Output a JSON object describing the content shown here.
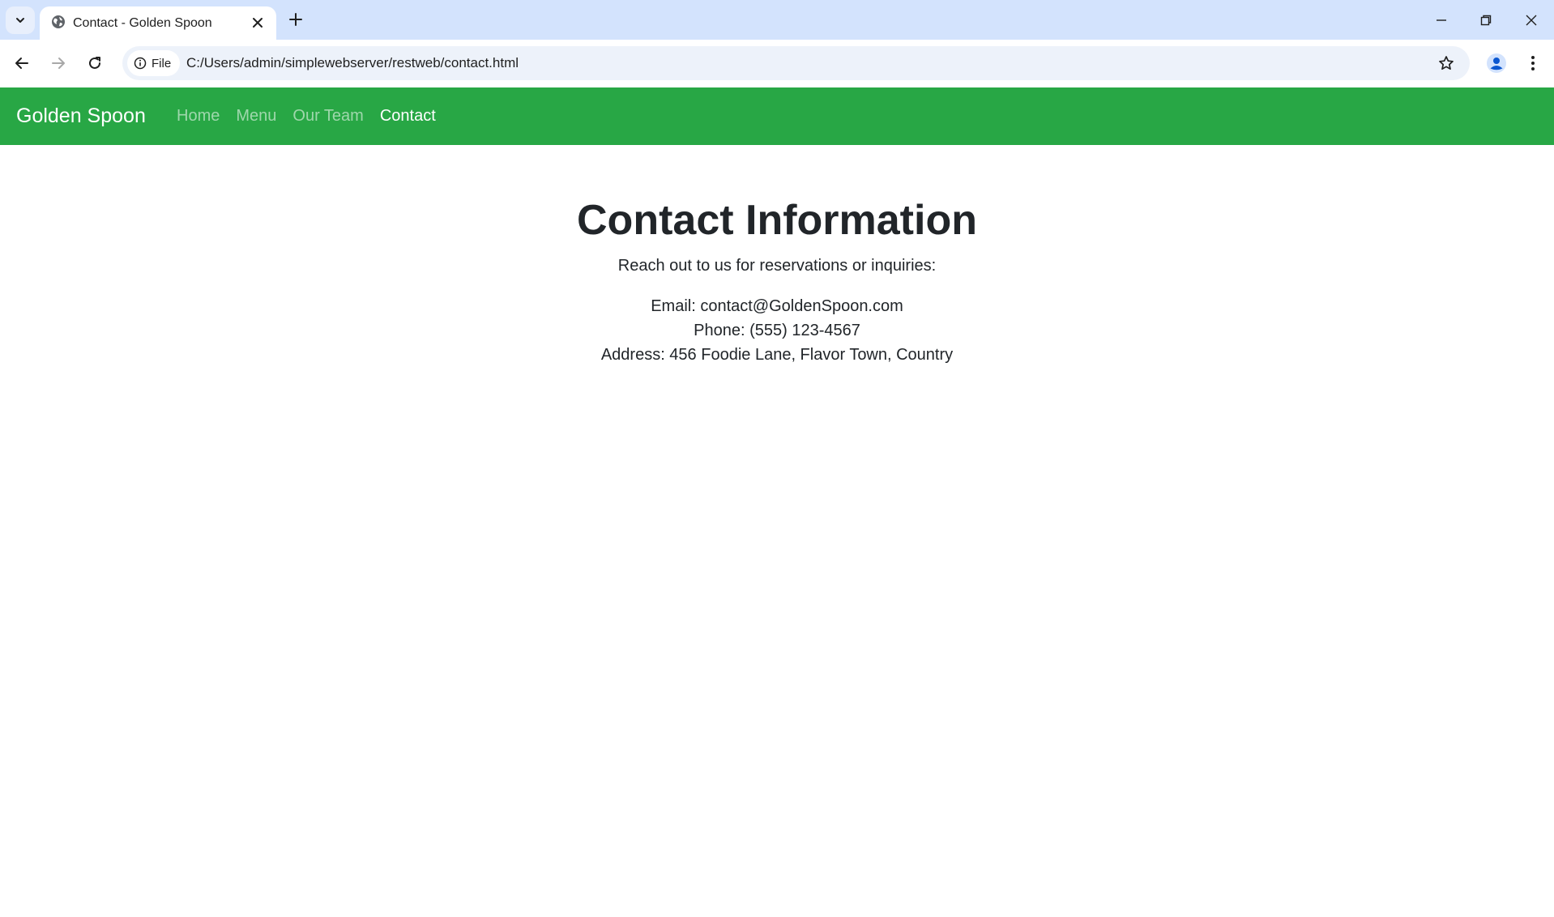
{
  "browser": {
    "tab_title": "Contact - Golden Spoon",
    "chip_label": "File",
    "url": "C:/Users/admin/simplewebserver/restweb/contact.html"
  },
  "site": {
    "brand": "Golden Spoon",
    "nav": [
      {
        "label": "Home",
        "active": false
      },
      {
        "label": "Menu",
        "active": false
      },
      {
        "label": "Our Team",
        "active": false
      },
      {
        "label": "Contact",
        "active": true
      }
    ],
    "nav_color": "#28a745"
  },
  "main": {
    "heading": "Contact Information",
    "intro": "Reach out to us for reservations or inquiries:",
    "email": "Email: contact@GoldenSpoon.com",
    "phone": "Phone: (555) 123-4567",
    "address": "Address: 456 Foodie Lane, Flavor Town, Country"
  }
}
